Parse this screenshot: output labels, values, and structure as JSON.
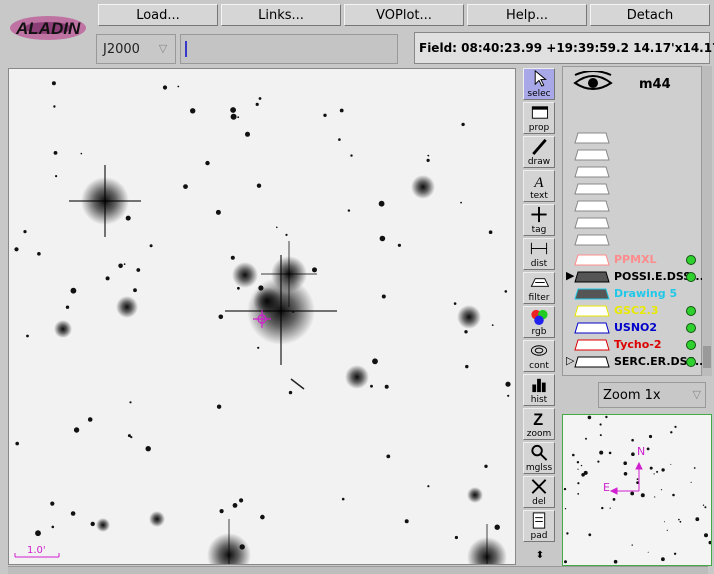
{
  "menu": {
    "items": [
      "Load...",
      "Links...",
      "VOPlot...",
      "Help...",
      "Detach"
    ]
  },
  "logo_text": "ALADIN",
  "frame": {
    "value": "J2000"
  },
  "field_info": "Field: 08:40:23.99 +19:39:59.2   14.17'x14.17'",
  "scale_label": "1.0'",
  "tools": [
    {
      "label": "selec",
      "icon": "cursor-icon"
    },
    {
      "label": "prop",
      "icon": "properties-icon"
    },
    {
      "label": "draw",
      "icon": "pencil-icon"
    },
    {
      "label": "text",
      "icon": "text-icon"
    },
    {
      "label": "tag",
      "icon": "crosshair-icon"
    },
    {
      "label": "dist",
      "icon": "distance-icon"
    },
    {
      "label": "filter",
      "icon": "filter-icon"
    },
    {
      "label": "rgb",
      "icon": "rgb-icon"
    },
    {
      "label": "cont",
      "icon": "contour-icon"
    },
    {
      "label": "hist",
      "icon": "histogram-icon"
    },
    {
      "label": "zoom",
      "icon": "zoom-z-icon"
    },
    {
      "label": "mglss",
      "icon": "magnifier-icon"
    },
    {
      "label": "del",
      "icon": "delete-icon"
    },
    {
      "label": "pad",
      "icon": "notepad-icon"
    }
  ],
  "stack": {
    "target": "m44",
    "planes": [
      {
        "name": "PPMXL",
        "color": "#ff8c8c"
      },
      {
        "name": "POSSI.E.DSS...",
        "color": "#000000"
      },
      {
        "name": "Drawing 5",
        "color": "#22c8e8"
      },
      {
        "name": "GSC2.3",
        "color": "#e8e800"
      },
      {
        "name": "USNO2",
        "color": "#0000cc"
      },
      {
        "name": "Tycho-2",
        "color": "#dd0000"
      },
      {
        "name": "SERC.ER.DSS...",
        "color": "#000000"
      }
    ]
  },
  "zoom": {
    "value": "Zoom 1x"
  },
  "compass": {
    "north": "N",
    "east": "E"
  }
}
